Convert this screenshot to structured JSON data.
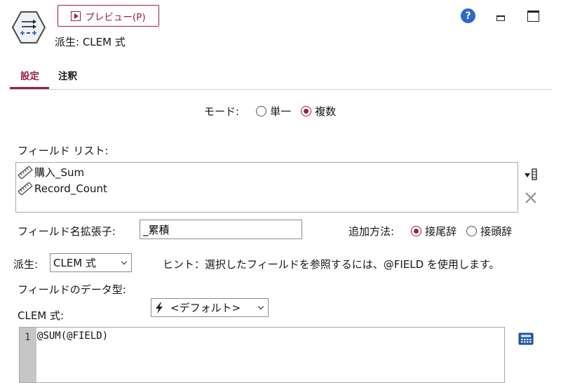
{
  "header": {
    "preview_button": "プレビュー(P)",
    "node_title": "派生: CLEM 式"
  },
  "tabs": [
    {
      "label": "設定",
      "active": true
    },
    {
      "label": "注釈",
      "active": false
    }
  ],
  "mode": {
    "label": "モード:",
    "options": [
      {
        "label": "単一",
        "selected": false
      },
      {
        "label": "複数",
        "selected": true
      }
    ]
  },
  "field_list": {
    "label": "フィールド リスト:",
    "items": [
      "購入_Sum",
      "Record_Count"
    ]
  },
  "suffix": {
    "label": "フィールド名拡張子:",
    "value": "_累積"
  },
  "add_method": {
    "label": "追加方法:",
    "options": [
      {
        "label": "接尾辞",
        "selected": true
      },
      {
        "label": "接頭辞",
        "selected": false
      }
    ]
  },
  "derive": {
    "label": "派生:",
    "selected": "CLEM 式",
    "hint": "ヒント：選択したフィールドを参照するには、@FIELD を使用します。"
  },
  "data_type": {
    "label": "フィールドのデータ型:",
    "selected": "<デフォルト>"
  },
  "clem": {
    "label": "CLEM 式:",
    "line_number": "1",
    "code": "@SUM(@FIELD)"
  },
  "help_icon_glyph": "?",
  "colors": {
    "accent": "#9a1e50",
    "help": "#2b68c9"
  }
}
